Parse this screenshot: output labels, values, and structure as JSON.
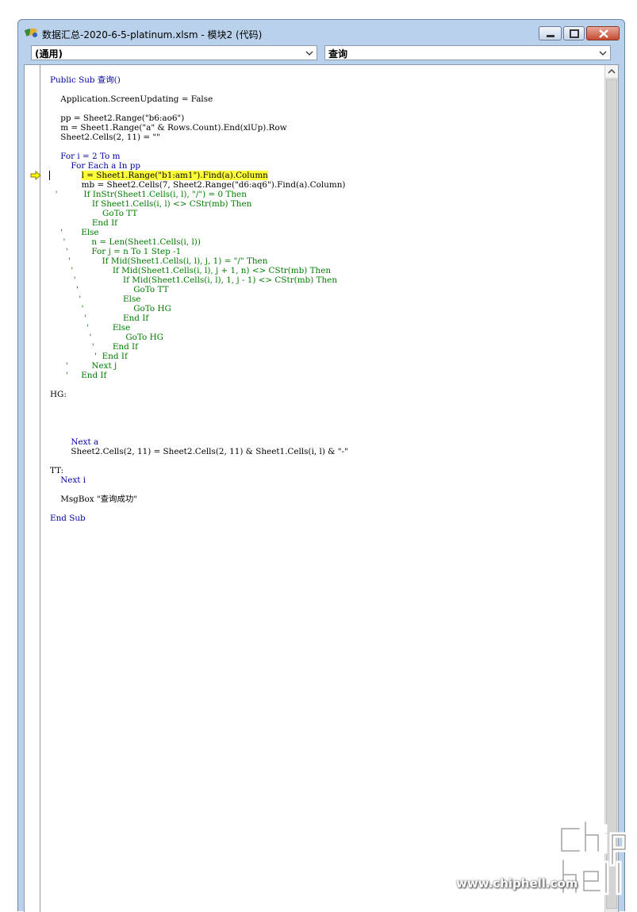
{
  "window": {
    "title": "数据汇总-2020-6-5-platinum.xlsm - 模块2 (代码)"
  },
  "toolbar": {
    "object_combo": "(通用)",
    "procedure_combo": "查询"
  },
  "code_lines": [
    {
      "t": "Public Sub 查询()",
      "c": "kw"
    },
    {
      "t": "",
      "c": "pl"
    },
    {
      "t": "    Application.ScreenUpdating = False",
      "c": "pl"
    },
    {
      "t": "",
      "c": "pl"
    },
    {
      "t": "    pp = Sheet2.Range(\"b6:ao6\")",
      "c": "pl"
    },
    {
      "t": "    m = Sheet1.Range(\"a\" & Rows.Count).End(xlUp).Row",
      "c": "pl"
    },
    {
      "t": "    Sheet2.Cells(2, 11) = \"\"",
      "c": "pl"
    },
    {
      "t": "",
      "c": "pl"
    },
    {
      "t": "    For i = 2 To m",
      "c": "kw"
    },
    {
      "t": "        For Each a In pp",
      "c": "kw"
    },
    {
      "t": "            l = Sheet1.Range(\"b1:am1\").Find(a).Column",
      "c": "pl",
      "hl": true
    },
    {
      "t": "            mb = Sheet2.Cells(7, Sheet2.Range(\"d6:aq6\").Find(a).Column)",
      "c": "pl"
    },
    {
      "t": "  '          If InStr(Sheet1.Cells(i, l), \"/\") = 0 Then",
      "c": "cm"
    },
    {
      "t": "                If Sheet1.Cells(i, l) <> CStr(mb) Then",
      "c": "cm"
    },
    {
      "t": "                    GoTo TT",
      "c": "cm"
    },
    {
      "t": "                End If",
      "c": "cm"
    },
    {
      "t": "    '       Else",
      "c": "cm"
    },
    {
      "t": "     '          n = Len(Sheet1.Cells(i, l))",
      "c": "cm"
    },
    {
      "t": "      '         For j = n To 1 Step -1",
      "c": "cm"
    },
    {
      "t": "       '            If Mid(Sheet1.Cells(i, l), j, 1) = \"/\" Then",
      "c": "cm"
    },
    {
      "t": "        '               If Mid(Sheet1.Cells(i, l), j + 1, n) <> CStr(mb) Then",
      "c": "cm"
    },
    {
      "t": "         '                  If Mid(Sheet1.Cells(i, l), 1, j - 1) <> CStr(mb) Then",
      "c": "cm"
    },
    {
      "t": "          '                     GoTo TT",
      "c": "cm"
    },
    {
      "t": "           '                Else",
      "c": "cm"
    },
    {
      "t": "            '                   GoTo HG",
      "c": "cm"
    },
    {
      "t": "             '              End If",
      "c": "cm"
    },
    {
      "t": "              '         Else",
      "c": "cm"
    },
    {
      "t": "               '             GoTo HG",
      "c": "cm"
    },
    {
      "t": "                '       End If",
      "c": "cm"
    },
    {
      "t": "                 '  End If",
      "c": "cm"
    },
    {
      "t": "      '         Next j",
      "c": "cm"
    },
    {
      "t": "      '     End If",
      "c": "cm"
    },
    {
      "t": "",
      "c": "pl"
    },
    {
      "t": "HG:",
      "c": "pl"
    },
    {
      "t": "",
      "c": "pl"
    },
    {
      "t": "",
      "c": "pl"
    },
    {
      "t": "",
      "c": "pl"
    },
    {
      "t": "",
      "c": "pl"
    },
    {
      "t": "        Next a",
      "c": "kw"
    },
    {
      "t": "        Sheet2.Cells(2, 11) = Sheet2.Cells(2, 11) & Sheet1.Cells(i, l) & \"-\"",
      "c": "pl"
    },
    {
      "t": "",
      "c": "pl"
    },
    {
      "t": "TT:",
      "c": "pl"
    },
    {
      "t": "    Next i",
      "c": "kw"
    },
    {
      "t": "",
      "c": "pl"
    },
    {
      "t": "    MsgBox \"查询成功\"",
      "c": "pl"
    },
    {
      "t": "",
      "c": "pl"
    },
    {
      "t": "End Sub",
      "c": "kw"
    }
  ],
  "watermark": {
    "text": "www.chiphell.com"
  }
}
